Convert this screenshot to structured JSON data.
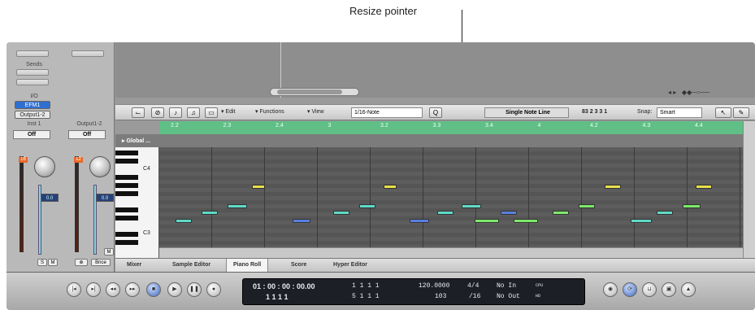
{
  "callout": {
    "label": "Resize pointer"
  },
  "strips": {
    "s1": {
      "sends": "Sends",
      "io": "I/O",
      "efm": "EFM1",
      "output": "Output1-2",
      "name": "Inst 1",
      "off": "Off",
      "level": "16",
      "value": "0.0",
      "s": "S",
      "m": "M"
    },
    "s2": {
      "name": "Output1-2",
      "off": "Off",
      "level": "12",
      "value": "0.0",
      "m": "M",
      "link": "⊕",
      "bnce": "Bnce"
    }
  },
  "toolbar": {
    "edit": "▾ Edit",
    "functions": "▾ Functions",
    "view": "▾ View",
    "quantize": "1/16-Note",
    "q_label": "Q",
    "track_name": "Single Note Line",
    "position": "83  2 3 3 1",
    "snap_label": "Snap:",
    "snap_value": "Smart"
  },
  "ruler": {
    "marks": [
      "2.2",
      "2.3",
      "2.4",
      "3",
      "3.2",
      "3.3",
      "3.4",
      "4",
      "4.2",
      "4.3",
      "4.4"
    ]
  },
  "global": {
    "label": "▸ Global ..."
  },
  "keys": {
    "c4": "C4",
    "c3": "C3"
  },
  "tabs": [
    "Mixer",
    "Sample Editor",
    "Piano Roll",
    "Score",
    "Hyper Editor"
  ],
  "active_tab": "Piano Roll",
  "transport": {
    "time_smpte": "01 : 00 : 00 : 00.00",
    "time_bars": "1    1    1    1",
    "loc1": "1    1    1    1",
    "loc2": "5    1    1    1",
    "tempo": "120.0000",
    "division": "103",
    "signature": "4/4",
    "sig_div": "/16",
    "in": "No In",
    "out": "No Out",
    "cpu": "CPU",
    "hd": "HD"
  }
}
